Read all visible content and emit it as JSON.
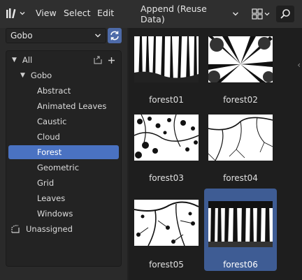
{
  "header": {
    "menu_view": "View",
    "menu_select": "Select",
    "menu_edit": "Edit",
    "append_mode": "Append (Reuse Data)"
  },
  "library": {
    "selected": "Gobo"
  },
  "tree": {
    "root": "All",
    "group": "Gobo",
    "items": [
      "Abstract",
      "Animated Leaves",
      "Caustic",
      "Cloud",
      "Forest",
      "Geometric",
      "Grid",
      "Leaves",
      "Windows"
    ],
    "selected_item": "Forest",
    "unassigned": "Unassigned"
  },
  "assets": [
    {
      "name": "forest01"
    },
    {
      "name": "forest02"
    },
    {
      "name": "forest03"
    },
    {
      "name": "forest04"
    },
    {
      "name": "forest05"
    },
    {
      "name": "forest06",
      "selected": true
    }
  ],
  "colors": {
    "accent": "#4a72c2",
    "selected_tile": "#3e5c94"
  }
}
